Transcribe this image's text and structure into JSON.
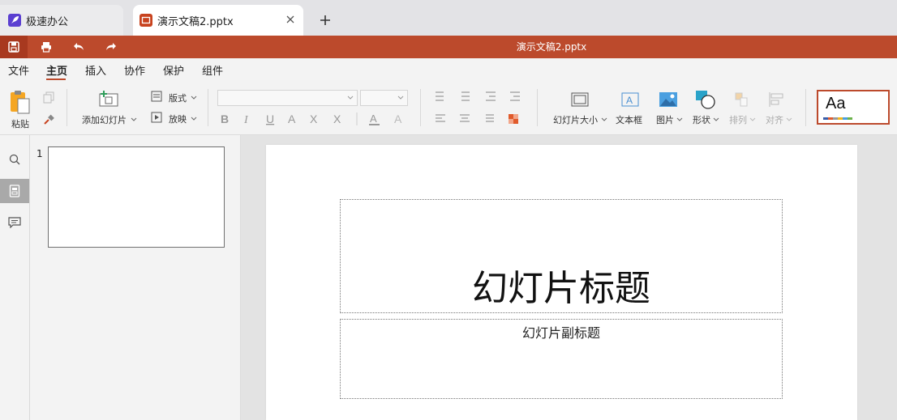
{
  "tabs": [
    {
      "label": "极速办公",
      "icon": "rocket-icon",
      "color": "#5b3fd1"
    },
    {
      "label": "演示文稿2.pptx",
      "icon": "presentation-icon",
      "color": "#c8431f"
    }
  ],
  "window": {
    "title": "演示文稿2.pptx",
    "accent": "#bc4a2c"
  },
  "menu": [
    "文件",
    "主页",
    "插入",
    "协作",
    "保护",
    "组件"
  ],
  "active_menu": "主页",
  "ribbon": {
    "paste": "粘贴",
    "add_slide": "添加幻灯片",
    "layout": "版式",
    "play": "放映",
    "slide_size": "幻灯片大小",
    "text_box": "文本框",
    "picture": "图片",
    "shape": "形状",
    "arrange": "排列",
    "align": "对齐",
    "theme_preview": "Aa"
  },
  "thumbnails": [
    {
      "number": "1"
    }
  ],
  "slide": {
    "title_placeholder": "幻灯片标题",
    "subtitle_placeholder": "幻灯片副标题"
  }
}
